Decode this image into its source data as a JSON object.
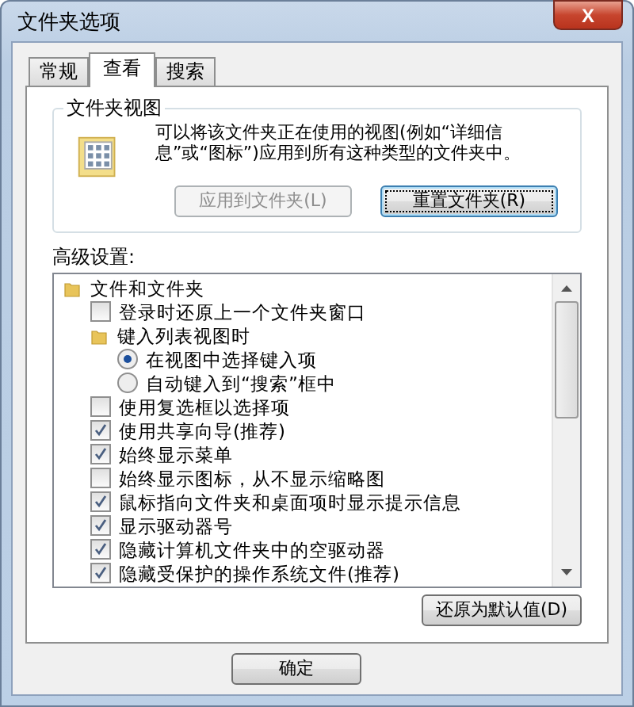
{
  "window": {
    "title": "文件夹选项",
    "close_label": "X"
  },
  "tabs": [
    {
      "label": "常规",
      "selected": false
    },
    {
      "label": "查看",
      "selected": true
    },
    {
      "label": "搜索",
      "selected": false
    }
  ],
  "folder_views": {
    "title": "文件夹视图",
    "description": "可以将该文件夹正在使用的视图(例如“详细信息”或“图标”)应用到所有这种类型的文件夹中。",
    "buttons": [
      {
        "label": "应用到文件夹(L)",
        "disabled": true,
        "focused": false
      },
      {
        "label": "重置文件夹(R)",
        "disabled": false,
        "focused": true
      }
    ]
  },
  "advanced": {
    "label": "高级设置:",
    "items": [
      {
        "kind": "folder",
        "label": "文件和文件夹",
        "children": [
          {
            "kind": "checkbox",
            "label": "登录时还原上一个文件夹窗口",
            "checked": false
          },
          {
            "kind": "folder",
            "label": "键入列表视图时",
            "children": [
              {
                "kind": "radio",
                "label": "在视图中选择键入项",
                "selected": true
              },
              {
                "kind": "radio",
                "label": "自动键入到“搜索”框中",
                "selected": false
              }
            ]
          },
          {
            "kind": "checkbox",
            "label": "使用复选框以选择项",
            "checked": false
          },
          {
            "kind": "checkbox",
            "label": "使用共享向导(推荐)",
            "checked": true
          },
          {
            "kind": "checkbox",
            "label": "始终显示菜单",
            "checked": true
          },
          {
            "kind": "checkbox",
            "label": "始终显示图标，从不显示缩略图",
            "checked": false
          },
          {
            "kind": "checkbox",
            "label": "鼠标指向文件夹和桌面项时显示提示信息",
            "checked": true
          },
          {
            "kind": "checkbox",
            "label": "显示驱动器号",
            "checked": true
          },
          {
            "kind": "checkbox",
            "label": "隐藏计算机文件夹中的空驱动器",
            "checked": true
          },
          {
            "kind": "checkbox",
            "label": "隐藏受保护的操作系统文件(推荐)",
            "checked": true
          }
        ]
      }
    ]
  },
  "restore_button": "还原为默认值(D)",
  "footer_buttons": [
    "确定"
  ]
}
